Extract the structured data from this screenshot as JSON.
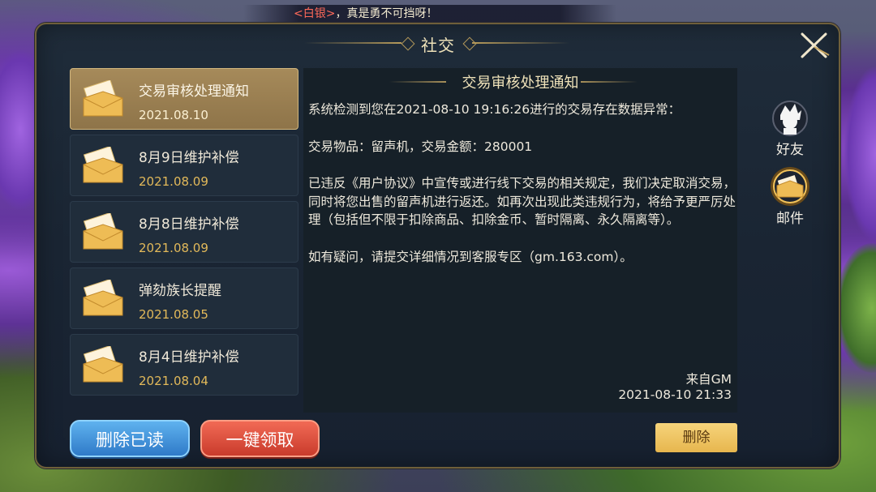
{
  "broadcast": {
    "name": "<白银>",
    "message": "，真是勇不可挡呀！"
  },
  "panel": {
    "title": "社交"
  },
  "mail_list": [
    {
      "title": "交易审核处理通知",
      "date": "2021.08.10",
      "selected": true
    },
    {
      "title": "8月9日维护补偿",
      "date": "2021.08.09",
      "selected": false
    },
    {
      "title": "8月8日维护补偿",
      "date": "2021.08.09",
      "selected": false
    },
    {
      "title": "弹劾族长提醒",
      "date": "2021.08.05",
      "selected": false
    },
    {
      "title": "8月4日维护补偿",
      "date": "2021.08.04",
      "selected": false
    }
  ],
  "mail": {
    "title": "交易审核处理通知",
    "paragraphs": [
      "系统检测到您在2021-08-10  19:16:26进行的交易存在数据异常：",
      "交易物品：留声机，交易金额：280001",
      "已违反《用户协议》中宣传或进行线下交易的相关规定，我们决定取消交易，同时将您出售的留声机进行返还。如再次出现此类违规行为，将给予更严厉处理（包括但不限于扣除商品、扣除金币、暂时隔离、永久隔离等）。",
      "如有疑问，请提交详细情况到客服专区（gm.163.com）。"
    ],
    "sender": "来自GM",
    "time": "2021-08-10  21:33"
  },
  "buttons": {
    "delete_read": "删除已读",
    "claim_all": "一键领取",
    "delete": "删除"
  },
  "side_tabs": {
    "friends": "好友",
    "mail": "邮件"
  },
  "colors": {
    "accent_gold": "#e2b95a",
    "panel_bg": "#1c2735",
    "selected_item": "#a68a5a"
  }
}
